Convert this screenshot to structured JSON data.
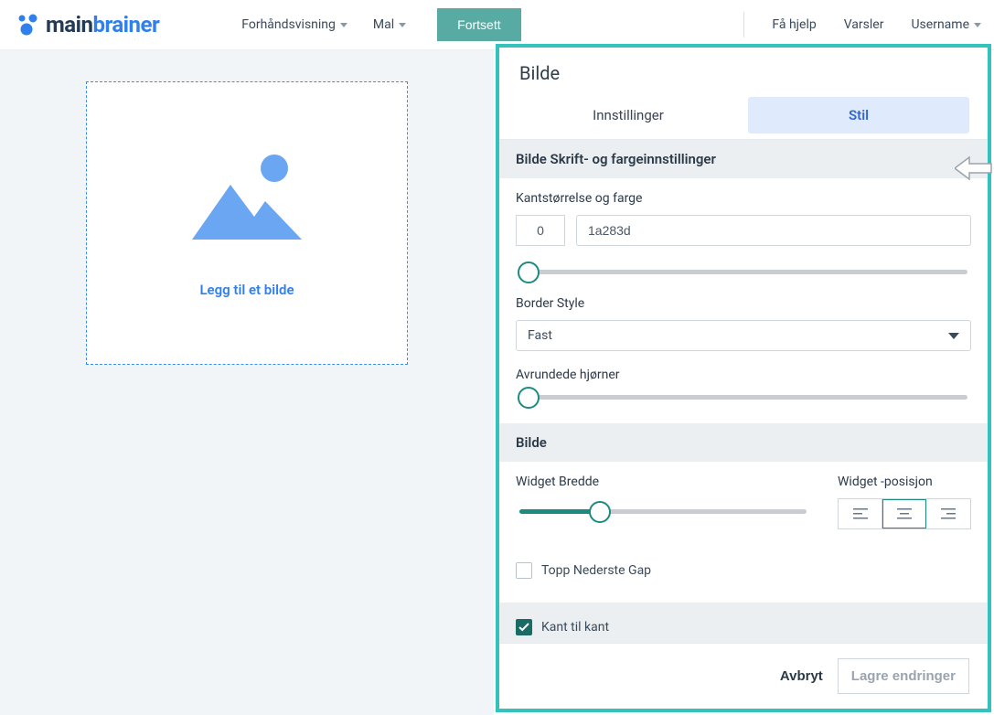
{
  "topbar": {
    "logo": {
      "part1": "main",
      "part2": "brainer"
    },
    "preview_label": "Forhåndsvisning",
    "template_label": "Mal",
    "continue_label": "Fortsett",
    "help_label": "Få hjelp",
    "alerts_label": "Varsler",
    "username_label": "Username"
  },
  "canvas": {
    "add_image_label": "Legg til et bilde"
  },
  "panel": {
    "title": "Bilde",
    "tabs": {
      "settings": "Innstillinger",
      "style": "Stil"
    },
    "section_font_color": "Bilde Skrift- og fargeinnstillinger",
    "border_size_color_label": "Kantstørrelse og farge",
    "border_size_value": "0",
    "border_color_value": "1a283d",
    "border_style_label": "Border Style",
    "border_style_value": "Fast",
    "rounded_corners_label": "Avrundede hjørner",
    "section_image": "Bilde",
    "widget_width_label": "Widget Bredde",
    "widget_position_label": "Widget -posisjon",
    "top_bottom_gap_label": "Topp Nederste Gap",
    "edge_to_edge_label": "Kant til kant",
    "footer": {
      "cancel": "Avbryt",
      "save": "Lagre endringer"
    }
  }
}
